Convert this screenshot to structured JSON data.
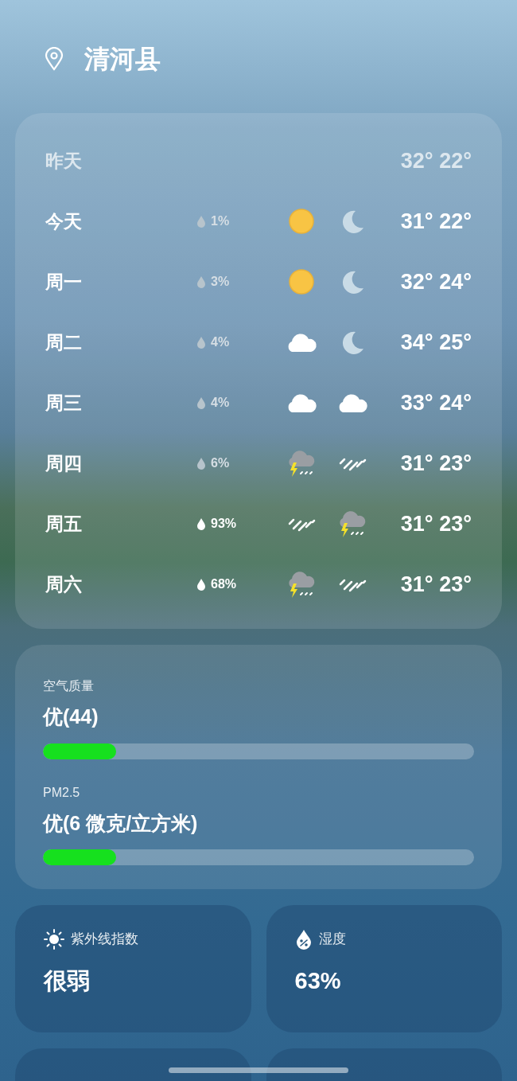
{
  "location": {
    "name": "清河县"
  },
  "forecast": [
    {
      "day": "昨天",
      "past": true,
      "temps": "32° 22°"
    },
    {
      "day": "今天",
      "past": false,
      "precip": "1%",
      "heavy": false,
      "daytime": {
        "kind": "sun"
      },
      "night": {
        "kind": "moon"
      },
      "temps": "31° 22°"
    },
    {
      "day": "周一",
      "past": false,
      "precip": "3%",
      "heavy": false,
      "daytime": {
        "kind": "sun"
      },
      "night": {
        "kind": "moon"
      },
      "temps": "32° 24°"
    },
    {
      "day": "周二",
      "past": false,
      "precip": "4%",
      "heavy": false,
      "daytime": {
        "kind": "cloud"
      },
      "night": {
        "kind": "moon"
      },
      "temps": "34° 25°"
    },
    {
      "day": "周三",
      "past": false,
      "precip": "4%",
      "heavy": false,
      "daytime": {
        "kind": "cloud"
      },
      "night": {
        "kind": "cloud"
      },
      "temps": "33° 24°"
    },
    {
      "day": "周四",
      "past": false,
      "precip": "6%",
      "heavy": false,
      "daytime": {
        "kind": "storm"
      },
      "night": {
        "kind": "rain"
      },
      "temps": "31° 23°"
    },
    {
      "day": "周五",
      "past": false,
      "precip": "93%",
      "heavy": true,
      "daytime": {
        "kind": "rain"
      },
      "night": {
        "kind": "storm"
      },
      "temps": "31° 23°"
    },
    {
      "day": "周六",
      "past": false,
      "precip": "68%",
      "heavy": true,
      "daytime": {
        "kind": "storm"
      },
      "night": {
        "kind": "rain"
      },
      "temps": "31° 23°"
    }
  ],
  "air": [
    {
      "label": "空气质量",
      "value": "优(44)",
      "level": 0.17
    },
    {
      "label": "PM2.5",
      "value": "优(6 微克/立方米)",
      "level": 0.17
    }
  ],
  "tiles": [
    {
      "kind": "uv",
      "label": "紫外线指数",
      "value": "很弱"
    },
    {
      "kind": "humidity",
      "label": "湿度",
      "value": "63%"
    }
  ]
}
